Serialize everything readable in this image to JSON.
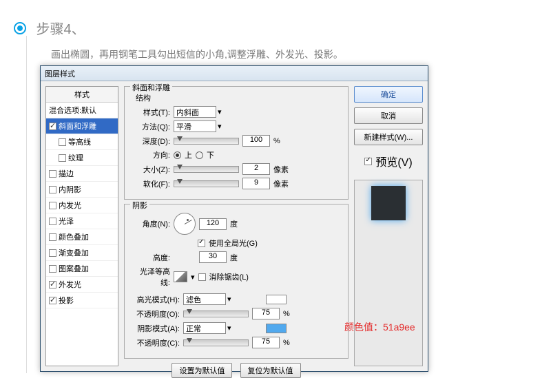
{
  "step": {
    "title": "步骤4、",
    "desc": "画出椭圆，再用钢笔工具勾出短信的小角,调整浮雕、外发光、投影。"
  },
  "dialog": {
    "title": "图层样式"
  },
  "styleList": {
    "header": "样式",
    "items": [
      {
        "label": "混合选项:默认",
        "checked": false,
        "sub": false,
        "selected": false,
        "nocb": true
      },
      {
        "label": "斜面和浮雕",
        "checked": true,
        "sub": false,
        "selected": true
      },
      {
        "label": "等高线",
        "checked": false,
        "sub": true
      },
      {
        "label": "纹理",
        "checked": false,
        "sub": true
      },
      {
        "label": "描边",
        "checked": false,
        "sub": false
      },
      {
        "label": "内阴影",
        "checked": false,
        "sub": false
      },
      {
        "label": "内发光",
        "checked": false,
        "sub": false
      },
      {
        "label": "光泽",
        "checked": false,
        "sub": false
      },
      {
        "label": "颜色叠加",
        "checked": false,
        "sub": false
      },
      {
        "label": "渐变叠加",
        "checked": false,
        "sub": false
      },
      {
        "label": "图案叠加",
        "checked": false,
        "sub": false
      },
      {
        "label": "外发光",
        "checked": true,
        "sub": false
      },
      {
        "label": "投影",
        "checked": true,
        "sub": false
      }
    ]
  },
  "bevel": {
    "groupTitle": "斜面和浮雕",
    "structTitle": "结构",
    "styleLabel": "样式(T):",
    "styleValue": "内斜面",
    "methodLabel": "方法(Q):",
    "methodValue": "平滑",
    "depthLabel": "深度(D):",
    "depthValue": "100",
    "depthUnit": "%",
    "dirLabel": "方向:",
    "dirUp": "上",
    "dirDown": "下",
    "sizeLabel": "大小(Z):",
    "sizeValue": "2",
    "sizeUnit": "像素",
    "softenLabel": "软化(F):",
    "softenValue": "9",
    "softenUnit": "像素"
  },
  "shade": {
    "title": "阴影",
    "angleLabel": "角度(N):",
    "angleValue": "120",
    "angleUnit": "度",
    "globalLabel": "使用全局光(G)",
    "altLabel": "高度:",
    "altValue": "30",
    "altUnit": "度",
    "glossLabel": "光泽等高线:",
    "aaLabel": "消除锯齿(L)",
    "hiModeLabel": "高光模式(H):",
    "hiModeValue": "滤色",
    "hiOpLabel": "不透明度(O):",
    "hiOpValue": "75",
    "hiOpUnit": "%",
    "shModeLabel": "阴影模式(A):",
    "shModeValue": "正常",
    "shOpLabel": "不透明度(C):",
    "shOpValue": "75",
    "shOpUnit": "%"
  },
  "bottomBtns": {
    "setDefault": "设置为默认值",
    "resetDefault": "复位为默认值"
  },
  "rightBtns": {
    "ok": "确定",
    "cancel": "取消",
    "newStyle": "新建样式(W)...",
    "preview": "预览(V)"
  },
  "annotation": "颜色值：51a9ee"
}
